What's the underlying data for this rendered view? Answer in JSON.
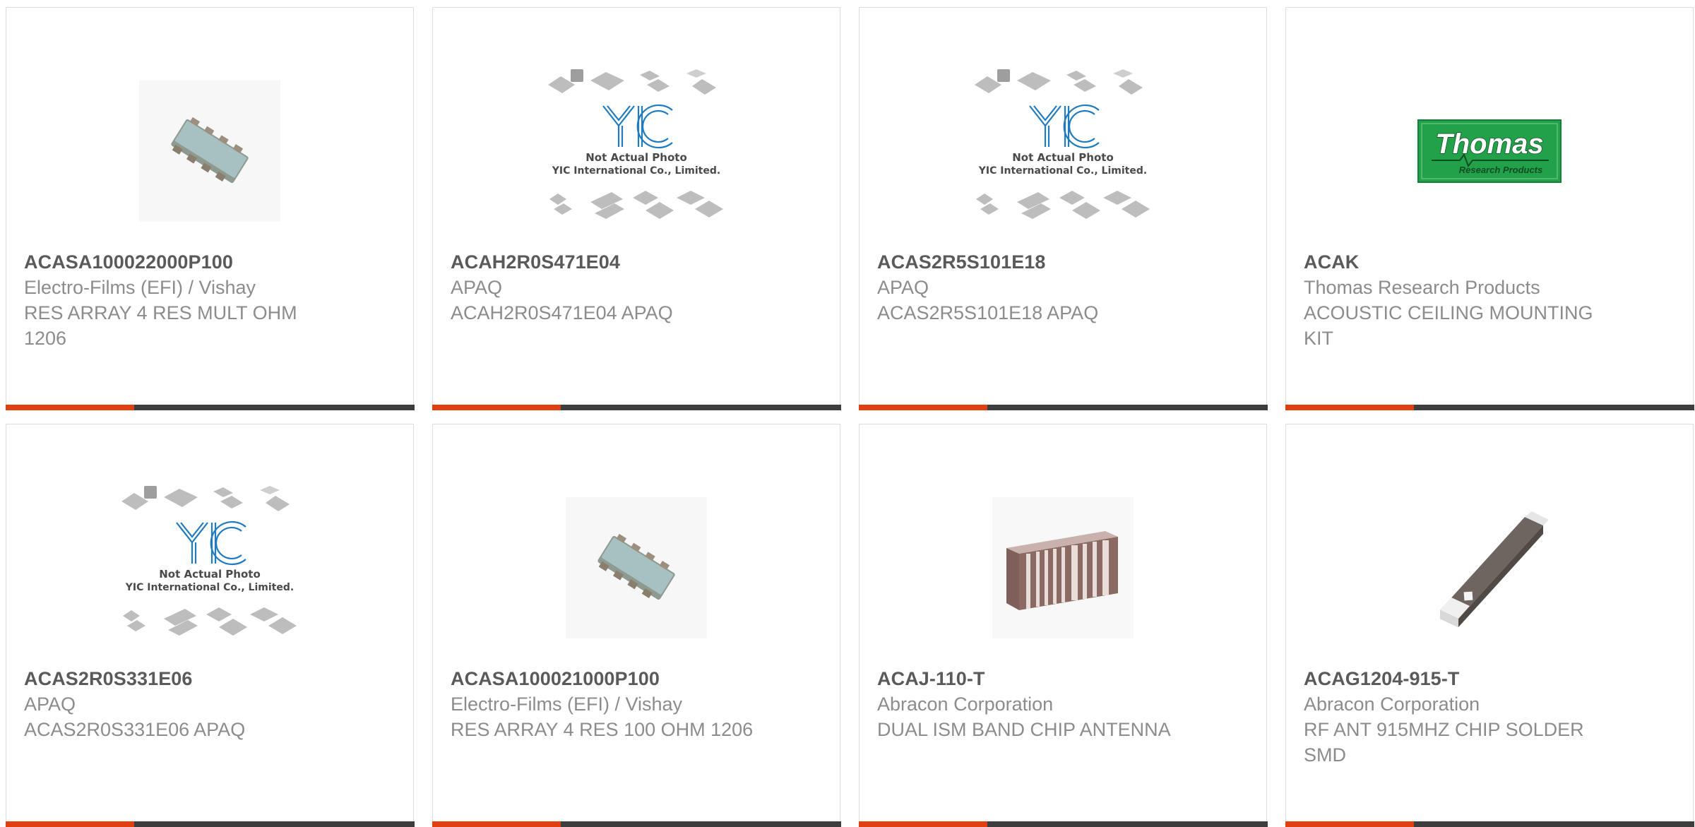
{
  "colors": {
    "accent": "#e0400f",
    "bar": "#3d3d3d",
    "part_number": "#5a5a5a",
    "text_muted": "#8c8c8c",
    "card_border": "#dedede"
  },
  "products": [
    {
      "part_number": "ACASA100022000P100",
      "manufacturer": "Electro-Films (EFI) / Vishay",
      "description": "RES ARRAY 4 RES MULT OHM 1206",
      "image": "resistor-array-chip-image"
    },
    {
      "part_number": "ACAH2R0S471E04",
      "manufacturer": "APAQ",
      "description": "ACAH2R0S471E04 APAQ",
      "image": "placeholder-image",
      "placeholder_caption_1": "Not Actual Photo",
      "placeholder_caption_2": "YIC International Co., Limited."
    },
    {
      "part_number": "ACAS2R5S101E18",
      "manufacturer": "APAQ",
      "description": "ACAS2R5S101E18 APAQ",
      "image": "placeholder-image",
      "placeholder_caption_1": "Not Actual Photo",
      "placeholder_caption_2": "YIC International Co., Limited."
    },
    {
      "part_number": "ACAK",
      "manufacturer": "Thomas Research Products",
      "description": "ACOUSTIC CEILING MOUNTING KIT",
      "image": "manufacturer-logo-image",
      "logo_title": "Thomas",
      "logo_subtitle": "Research Products"
    },
    {
      "part_number": "ACAS2R0S331E06",
      "manufacturer": "APAQ",
      "description": "ACAS2R0S331E06 APAQ",
      "image": "placeholder-image",
      "placeholder_caption_1": "Not Actual Photo",
      "placeholder_caption_2": "YIC International Co., Limited."
    },
    {
      "part_number": "ACASA100021000P100",
      "manufacturer": "Electro-Films (EFI) / Vishay",
      "description": "RES ARRAY 4 RES 100 OHM 1206",
      "image": "resistor-array-chip-image"
    },
    {
      "part_number": "ACAJ-110-T",
      "manufacturer": "Abracon Corporation",
      "description": "DUAL ISM BAND CHIP ANTENNA",
      "image": "chip-antenna-image"
    },
    {
      "part_number": "ACAG1204-915-T",
      "manufacturer": "Abracon Corporation",
      "description": "RF ANT 915MHZ CHIP SOLDER SMD",
      "image": "smd-chip-image"
    }
  ]
}
